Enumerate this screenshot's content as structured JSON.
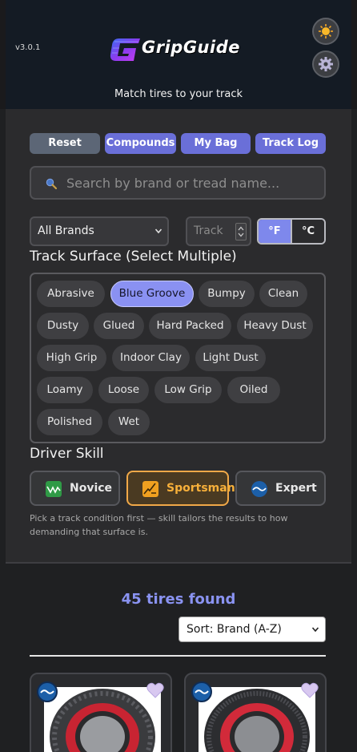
{
  "header": {
    "version": "v3.0.1",
    "app_name": "GripGuide",
    "tagline": "Match tires to your track",
    "theme_icon": "sun-icon",
    "settings_icon": "gear-icon"
  },
  "toolbar": {
    "reset_label": "Reset",
    "compounds_label": "Compounds",
    "mybag_label": "My Bag",
    "tracklog_label": "Track Log"
  },
  "search": {
    "placeholder": "Search by brand or tread name...",
    "icon": "search-icon"
  },
  "filters": {
    "brand_value": "All Brands",
    "temp_placeholder": "Track Temp",
    "unit_f": "°F",
    "unit_c": "°C",
    "selected_unit": "°F"
  },
  "surface": {
    "title": "Track Surface (Select Multiple)",
    "chips": [
      {
        "label": "Abrasive",
        "selected": false
      },
      {
        "label": "Blue Groove",
        "selected": true
      },
      {
        "label": "Bumpy",
        "selected": false
      },
      {
        "label": "Clean",
        "selected": false
      },
      {
        "label": "Dusty",
        "selected": false
      },
      {
        "label": "Glued",
        "selected": false
      },
      {
        "label": "Hard Packed",
        "selected": false
      },
      {
        "label": "Heavy Dust",
        "selected": false
      },
      {
        "label": "High Grip",
        "selected": false
      },
      {
        "label": "Indoor Clay",
        "selected": false
      },
      {
        "label": "Light Dust",
        "selected": false
      },
      {
        "label": "Loamy",
        "selected": false
      },
      {
        "label": "Loose",
        "selected": false
      },
      {
        "label": "Low Grip",
        "selected": false
      },
      {
        "label": "Oiled",
        "selected": false
      },
      {
        "label": "Polished",
        "selected": false
      },
      {
        "label": "Wet",
        "selected": false
      }
    ]
  },
  "skill": {
    "title": "Driver Skill",
    "options": [
      {
        "label": "Novice",
        "selected": false,
        "icon": "novice-icon"
      },
      {
        "label": "Sportsman",
        "selected": true,
        "icon": "sportsman-icon"
      },
      {
        "label": "Expert",
        "selected": false,
        "icon": "expert-icon"
      }
    ],
    "hint": "Pick a track condition first — skill tailors the results to how demanding that surface is."
  },
  "results": {
    "count_text": "45 tires found",
    "sort_value": "Sort: Brand (A-Z)"
  },
  "colors": {
    "accent": "#6a6fd8",
    "selected_chip": "#8a91f2",
    "sportsman": "#f0a848",
    "count_text": "#8a93f2"
  }
}
